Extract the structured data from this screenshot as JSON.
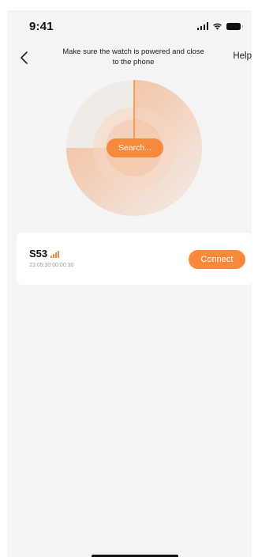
{
  "status_bar": {
    "time": "9:41",
    "icons": [
      "signal-icon",
      "wifi-icon",
      "battery-icon"
    ]
  },
  "header": {
    "back_icon": "chevron-left-icon",
    "instruction": "Make sure the watch is powered and close to the phone",
    "help_label": "Help"
  },
  "scanner": {
    "button_label": "Search..."
  },
  "device": {
    "name": "S53",
    "mac": "23:05:30:00:00:30",
    "signal_icon": "signal-strength-icon",
    "connect_label": "Connect"
  },
  "colors": {
    "accent": "#f6893b",
    "background": "#f4f4f5",
    "card": "#ffffff"
  }
}
